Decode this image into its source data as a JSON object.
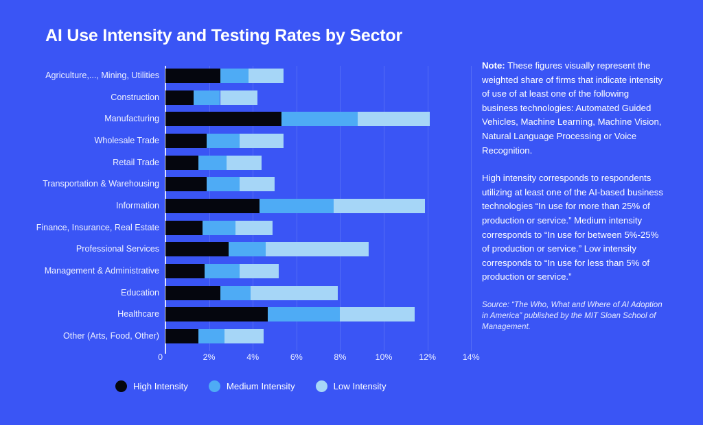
{
  "title": "AI Use Intensity and Testing Rates by Sector",
  "legend": {
    "items": [
      {
        "label": "High Intensity",
        "color": "#05060e"
      },
      {
        "label": "Medium Intensity",
        "color": "#4eabf5"
      },
      {
        "label": "Low Intensity",
        "color": "#a6d6f7"
      }
    ]
  },
  "notes": {
    "note_label": "Note:",
    "paragraph1": " These figures visually represent the weighted share of firms that indicate intensity of use of at least one of the following business technologies: Automated Guided Vehicles, Machine Learning, Machine Vision, Natural Language Processing or Voice Recognition.",
    "paragraph2": "High intensity corresponds to respondents utilizing at least one of the AI-based business technologies “In use for more than 25% of production or service.” Medium intensity corresponds to “In use for between 5%-25% of production or service.” Low intensity corresponds to “In use for less than 5% of production or service.”",
    "source": "Source: “The Who, What and Where of AI Adoption in America” published by the MIT Sloan School of Management."
  },
  "chart_data": {
    "type": "bar",
    "orientation": "horizontal",
    "stacked": true,
    "title": "AI Use Intensity and Testing Rates by Sector",
    "xlabel": "",
    "ylabel": "",
    "xlim": [
      0,
      14
    ],
    "xunit": "%",
    "xticks": [
      "0",
      "2%",
      "4%",
      "6%",
      "8%",
      "10%",
      "12%",
      "14%"
    ],
    "xtick_values": [
      0,
      2,
      4,
      6,
      8,
      10,
      12,
      14
    ],
    "grid": "vertical",
    "legend_position": "bottom-left",
    "categories": [
      "Agriculture,..., Mining, Utilities",
      "Construction",
      "Manufacturing",
      "Wholesale Trade",
      "Retail Trade",
      "Transportation & Warehousing",
      "Information",
      "Finance, Insurance, Real Estate",
      "Professional Services",
      "Management & Administrative",
      "Education",
      "Healthcare",
      "Other (Arts, Food, Other)"
    ],
    "series": [
      {
        "name": "High Intensity",
        "color": "#05060e",
        "values": [
          2.5,
          1.3,
          5.3,
          1.9,
          1.5,
          1.9,
          4.3,
          1.7,
          2.9,
          1.8,
          2.5,
          4.7,
          1.5
        ]
      },
      {
        "name": "Medium Intensity",
        "color": "#4eabf5",
        "values": [
          1.3,
          1.2,
          3.5,
          1.5,
          1.3,
          1.5,
          3.4,
          1.5,
          1.7,
          1.6,
          1.4,
          3.3,
          1.2
        ]
      },
      {
        "name": "Low Intensity",
        "color": "#a6d6f7",
        "values": [
          1.6,
          1.7,
          3.3,
          2.0,
          1.6,
          1.6,
          4.2,
          1.7,
          4.7,
          1.8,
          4.0,
          3.4,
          1.8
        ]
      }
    ],
    "totals": [
      5.4,
      4.2,
      12.1,
      5.4,
      4.4,
      5.0,
      11.9,
      4.9,
      9.3,
      5.2,
      7.9,
      11.4,
      4.5
    ]
  }
}
